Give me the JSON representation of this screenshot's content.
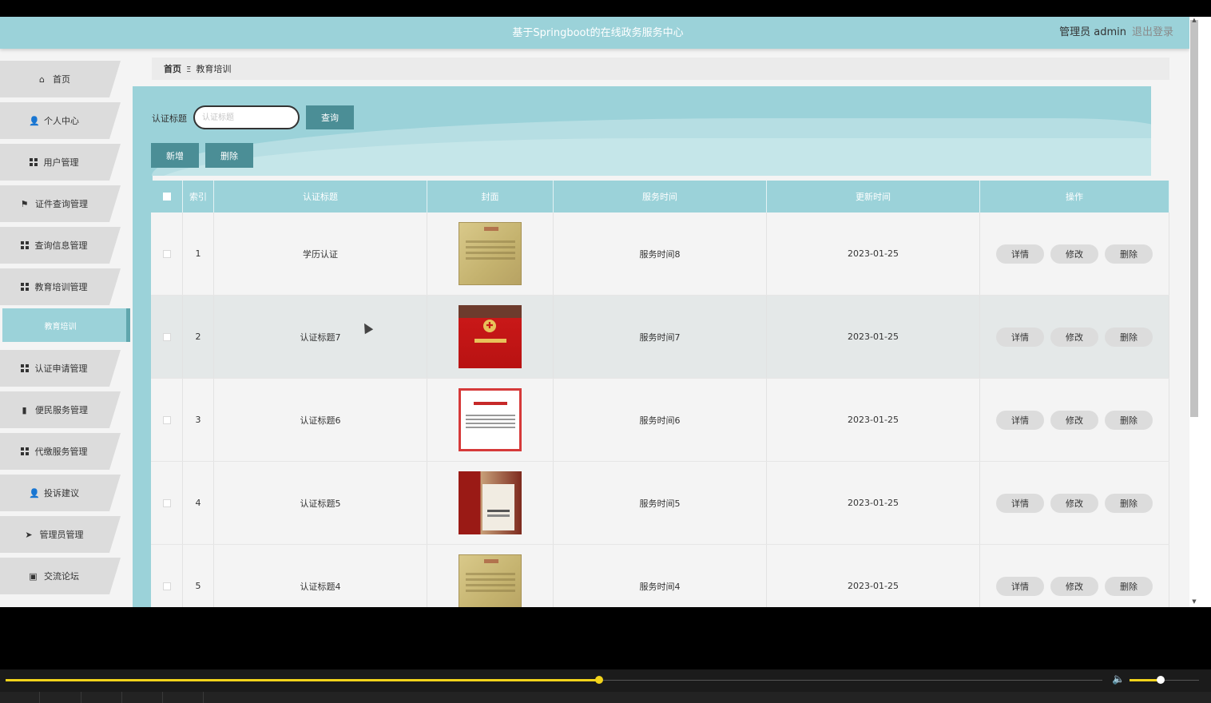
{
  "header": {
    "site_title": "基于Springboot的在线政务服务中心",
    "admin_label": "管理员 admin",
    "logout_label": "退出登录"
  },
  "sidebar": {
    "items": [
      {
        "label": "首页",
        "icon": "home-icon"
      },
      {
        "label": "个人中心",
        "icon": "user-icon"
      },
      {
        "label": "用户管理",
        "icon": "grid-icon"
      },
      {
        "label": "证件查询管理",
        "icon": "flag-icon"
      },
      {
        "label": "查询信息管理",
        "icon": "grid-icon"
      },
      {
        "label": "教育培训管理",
        "icon": "grid-icon"
      },
      {
        "label": "认证申请管理",
        "icon": "grid-icon"
      },
      {
        "label": "便民服务管理",
        "icon": "bar-chart-icon"
      },
      {
        "label": "代缴服务管理",
        "icon": "grid-icon"
      },
      {
        "label": "投诉建议",
        "icon": "user-icon"
      },
      {
        "label": "管理员管理",
        "icon": "send-icon"
      },
      {
        "label": "交流论坛",
        "icon": "clipboard-icon"
      }
    ],
    "active_sub": "教育培训"
  },
  "breadcrumb": {
    "home": "首页",
    "separator": "Ξ",
    "current": "教育培训"
  },
  "search": {
    "label": "认证标题",
    "placeholder": "认证标题",
    "button": "查询"
  },
  "toolbar": {
    "add_label": "新增",
    "delete_label": "删除"
  },
  "table": {
    "columns": [
      "索引",
      "认证标题",
      "封面",
      "服务时间",
      "更新时间",
      "操作"
    ],
    "rows": [
      {
        "index": "1",
        "title": "学历认证",
        "cover": "gold-certificate",
        "service_time": "服务时间8",
        "updated": "2023-01-25"
      },
      {
        "index": "2",
        "title": "认证标题7",
        "cover": "red-donation-book",
        "service_time": "服务时间7",
        "updated": "2023-01-25"
      },
      {
        "index": "3",
        "title": "认证标题6",
        "cover": "framed-certificate",
        "service_time": "服务时间6",
        "updated": "2023-01-25"
      },
      {
        "index": "4",
        "title": "认证标题5",
        "cover": "certificate-photo",
        "service_time": "服务时间5",
        "updated": "2023-01-25"
      },
      {
        "index": "5",
        "title": "认证标题4",
        "cover": "gold-certificate",
        "service_time": "服务时间4",
        "updated": "2023-01-25"
      }
    ],
    "actions": {
      "detail": "详情",
      "edit": "修改",
      "delete": "删除"
    }
  },
  "player": {
    "progress": 0.49,
    "volume": 0.45
  },
  "colors": {
    "accent": "#9bd2d9",
    "button": "#4b8e96",
    "progress": "#f2d31b"
  }
}
